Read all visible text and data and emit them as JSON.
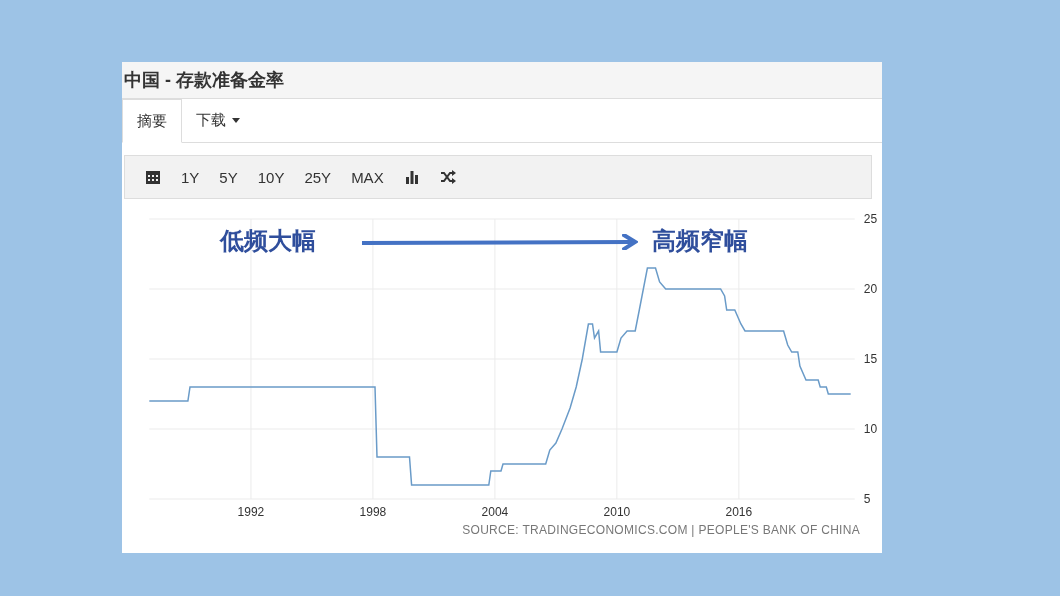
{
  "window": {
    "title": "中国 - 存款准备金率"
  },
  "tabs": [
    {
      "label": "摘要",
      "selected": true,
      "kind": "plain"
    },
    {
      "label": "下载",
      "selected": false,
      "kind": "dropdown"
    }
  ],
  "toolbar": {
    "ranges": [
      "1Y",
      "5Y",
      "10Y",
      "25Y",
      "MAX"
    ]
  },
  "chart": {
    "chart_data": {
      "type": "line",
      "xlim": [
        1987,
        2021.7
      ],
      "ylim": [
        5,
        25
      ],
      "xticks": [
        1992,
        1998,
        2004,
        2010,
        2016
      ],
      "yticks": [
        5,
        10,
        15,
        20,
        25
      ],
      "x": [
        1987,
        1988.9,
        1989,
        1998.1,
        1998.2,
        1999.8,
        1999.9,
        2003.7,
        2003.8,
        2004.3,
        2004.4,
        2006.5,
        2006.7,
        2007,
        2007.3,
        2007.7,
        2008,
        2008.3,
        2008.6,
        2008.8,
        2008.9,
        2009.1,
        2009.2,
        2010,
        2010.2,
        2010.5,
        2010.9,
        2011.1,
        2011.5,
        2011.9,
        2012.1,
        2012.4,
        2015.1,
        2015.3,
        2015.4,
        2015.8,
        2016.1,
        2016.3,
        2018.2,
        2018.4,
        2018.6,
        2018.9,
        2019,
        2019.3,
        2019.9,
        2020,
        2020.3,
        2020.4,
        2021.5
      ],
      "grid": true,
      "series": [
        {
          "color": "#6a9bc8",
          "values": [
            12,
            12,
            13,
            13,
            8,
            8,
            6,
            6,
            7,
            7,
            7.5,
            7.5,
            8.5,
            9,
            10,
            11.5,
            13,
            15,
            17.5,
            17.5,
            16.5,
            17,
            15.5,
            15.5,
            16.5,
            17,
            17,
            18.5,
            21.5,
            21.5,
            20.5,
            20,
            20,
            19.5,
            18.5,
            18.5,
            17.5,
            17,
            17,
            16,
            15.5,
            15.5,
            14.5,
            13.5,
            13.5,
            13,
            13,
            12.5,
            12.5
          ]
        }
      ],
      "annotations": [
        "低频大幅",
        "高频窄幅"
      ]
    },
    "source": "SOURCE: TRADINGECONOMICS.COM | PEOPLE'S BANK OF CHINA"
  }
}
